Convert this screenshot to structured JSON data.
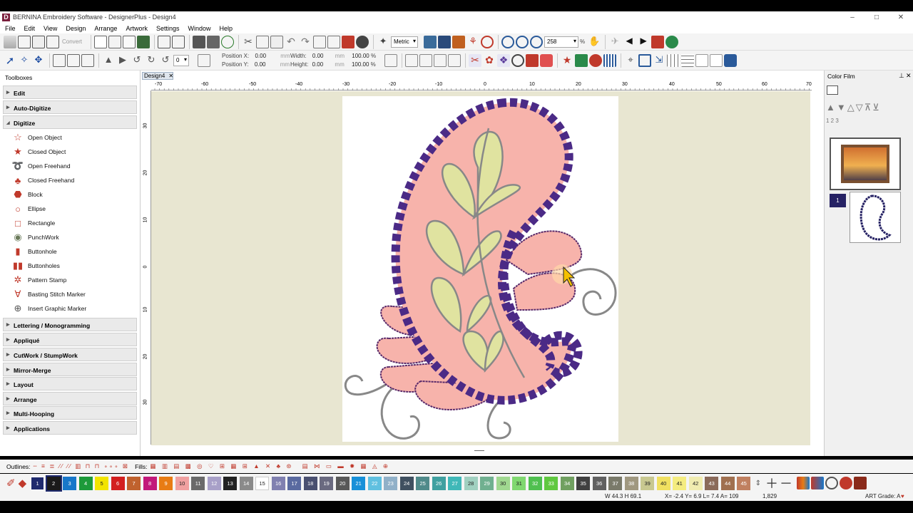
{
  "window": {
    "title": "BERNINA Embroidery Software - DesignerPlus - Design4",
    "logo_letter": "D"
  },
  "menu": [
    "File",
    "Edit",
    "View",
    "Design",
    "Arrange",
    "Artwork",
    "Settings",
    "Window",
    "Help"
  ],
  "toolbar": {
    "convert_label": "Convert",
    "units": "Metric",
    "zoom": "258",
    "zoom_unit": "%"
  },
  "position": {
    "x_label": "Position X:",
    "y_label": "Position Y:",
    "x": "0.00",
    "y": "0.00",
    "unit": "mm",
    "rot": "0"
  },
  "size": {
    "w_label": "Width:",
    "h_label": "Height:",
    "w": "0.00",
    "h": "0.00",
    "unit": "mm",
    "wp": "100.00",
    "hp": "100.00",
    "pct": "%"
  },
  "toolboxes": {
    "title": "Toolboxes",
    "sections": [
      "Edit",
      "Auto-Digitize",
      "Digitize",
      "Lettering / Monogramming",
      "Appliqué",
      "CutWork / StumpWork",
      "Mirror-Merge",
      "Layout",
      "Arrange",
      "Multi-Hooping",
      "Applications"
    ],
    "digitize_tools": [
      "Open Object",
      "Closed Object",
      "Open Freehand",
      "Closed Freehand",
      "Block",
      "Ellipse",
      "Rectangle",
      "PunchWork",
      "Buttonhole",
      "Buttonholes",
      "Pattern Stamp",
      "Basting Stitch Marker",
      "Insert Graphic Marker"
    ]
  },
  "document": {
    "tab": "Design4",
    "ruler_h": [
      "-70",
      "-60",
      "-50",
      "-40",
      "-30",
      "-20",
      "-10",
      "0",
      "10",
      "20",
      "30",
      "40",
      "50",
      "60",
      "70"
    ],
    "ruler_v": [
      "30",
      "20",
      "10",
      "0",
      "10",
      "20",
      "30"
    ]
  },
  "color_film": {
    "title": "Color Film",
    "numbers": "1 2 3",
    "item_number": "1"
  },
  "bottom": {
    "outlines_label": "Outlines:",
    "fills_label": "Fills:"
  },
  "palette": {
    "numbers": [
      "1",
      "2",
      "3",
      "4",
      "5",
      "6",
      "7",
      "8",
      "9",
      "10",
      "11",
      "12",
      "13",
      "14",
      "15",
      "16",
      "17",
      "18",
      "19",
      "20",
      "21",
      "22",
      "23",
      "24",
      "25",
      "26",
      "27",
      "28",
      "29",
      "30",
      "31",
      "32",
      "33",
      "34",
      "35",
      "36",
      "37",
      "38",
      "39",
      "40",
      "41",
      "42",
      "43",
      "44",
      "45"
    ],
    "colors": [
      "#1f2a6e",
      "#1a1a1a",
      "#1877c9",
      "#1d9a3a",
      "#f2e400",
      "#d32020",
      "#c0622e",
      "#c2187a",
      "#e87c14",
      "#f0a0a0",
      "#6a6a6a",
      "#a8a0c8",
      "#222222",
      "#8a8a8a",
      "#ffffff",
      "#8080b0",
      "#5a6aa0",
      "#4a5070",
      "#6a6a80",
      "#585858",
      "#1890d8",
      "#60c0e0",
      "#90b0c8",
      "#405060",
      "#508a8a",
      "#40a0a0",
      "#40b8b8",
      "#a0d0c0",
      "#70b090",
      "#a0d890",
      "#80d870",
      "#50c050",
      "#60c840",
      "#70a060",
      "#404040",
      "#606060",
      "#7a7a6a",
      "#a09880",
      "#c8c890",
      "#f0e060",
      "#f4ec80",
      "#f0ecb0",
      "#8a6a5a",
      "#a07050",
      "#c08060"
    ]
  },
  "status": {
    "wh": "W 44.3 H 69.1",
    "xy": "X= -2.4 Y= 6.9 L= 7.4 A= 109",
    "count": "1,829",
    "grade": "ART Grade: A"
  },
  "colors": {
    "accent": "#c0392b",
    "fill_pink": "#f7b3ab",
    "fill_green": "#e0e3a0",
    "satin_purple": "#4b2a86"
  }
}
